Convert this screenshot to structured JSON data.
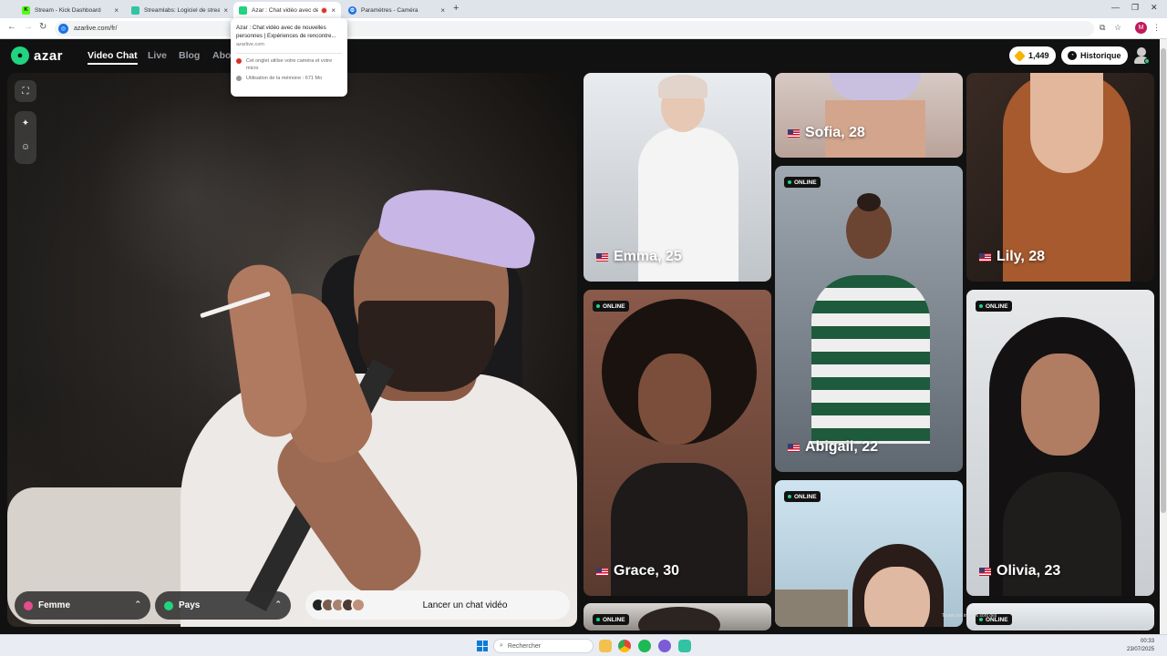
{
  "browser": {
    "tabs": [
      {
        "title": "Stream - Kick Dashboard",
        "fav_letter": "K",
        "fav_color": "#53fc18"
      },
      {
        "title": "Streamlabs: Logiciel de stream",
        "fav_letter": "",
        "fav_color": "#31c3a2"
      },
      {
        "title": "Azar : Chat vidéo avec de n",
        "fav_letter": "",
        "fav_color": "#22d37f"
      },
      {
        "title": "Paramètres - Caméra",
        "fav_letter": "",
        "fav_color": "#1a73e8"
      }
    ],
    "url": "azarlive.com/fr/",
    "profile_letter": "M",
    "tab_popup": {
      "title": "Azar : Chat vidéo avec de nouvelles personnes | Expériences de rencontre...",
      "domain": "azarlive.com",
      "camera_notice": "Cet onglet utilise votre caméra et votre micro",
      "memory_notice": "Utilisation de la mémoire : 671 Mo"
    }
  },
  "app": {
    "logo_text": "azar",
    "nav": [
      "Video Chat",
      "Live",
      "Blog",
      "Abo"
    ],
    "gems": "1,449",
    "history_label": "Historique",
    "accent_color": "#22d37f"
  },
  "self_view": {
    "gender_filter": "Femme",
    "country_filter": "Pays",
    "start_button": "Lancer un chat vidéo"
  },
  "profiles": [
    {
      "name": "Emma, 25",
      "online": false
    },
    {
      "name": "Sofia, 28",
      "online": false
    },
    {
      "name": "Lily, 28",
      "online": false
    },
    {
      "name": "Abigail, 22",
      "online": true
    },
    {
      "name": "Grace, 30",
      "online": true
    },
    {
      "name": "Olivia, 23",
      "online": true
    },
    {
      "name": "",
      "online": true
    },
    {
      "name": "",
      "online": true
    },
    {
      "name": "",
      "online": true
    }
  ],
  "online_label": "ONLINE",
  "disclaimer": "Toutes les images sont des",
  "taskbar": {
    "search_placeholder": "Rechercher",
    "time": "00:33",
    "date": "23/07/2025"
  }
}
